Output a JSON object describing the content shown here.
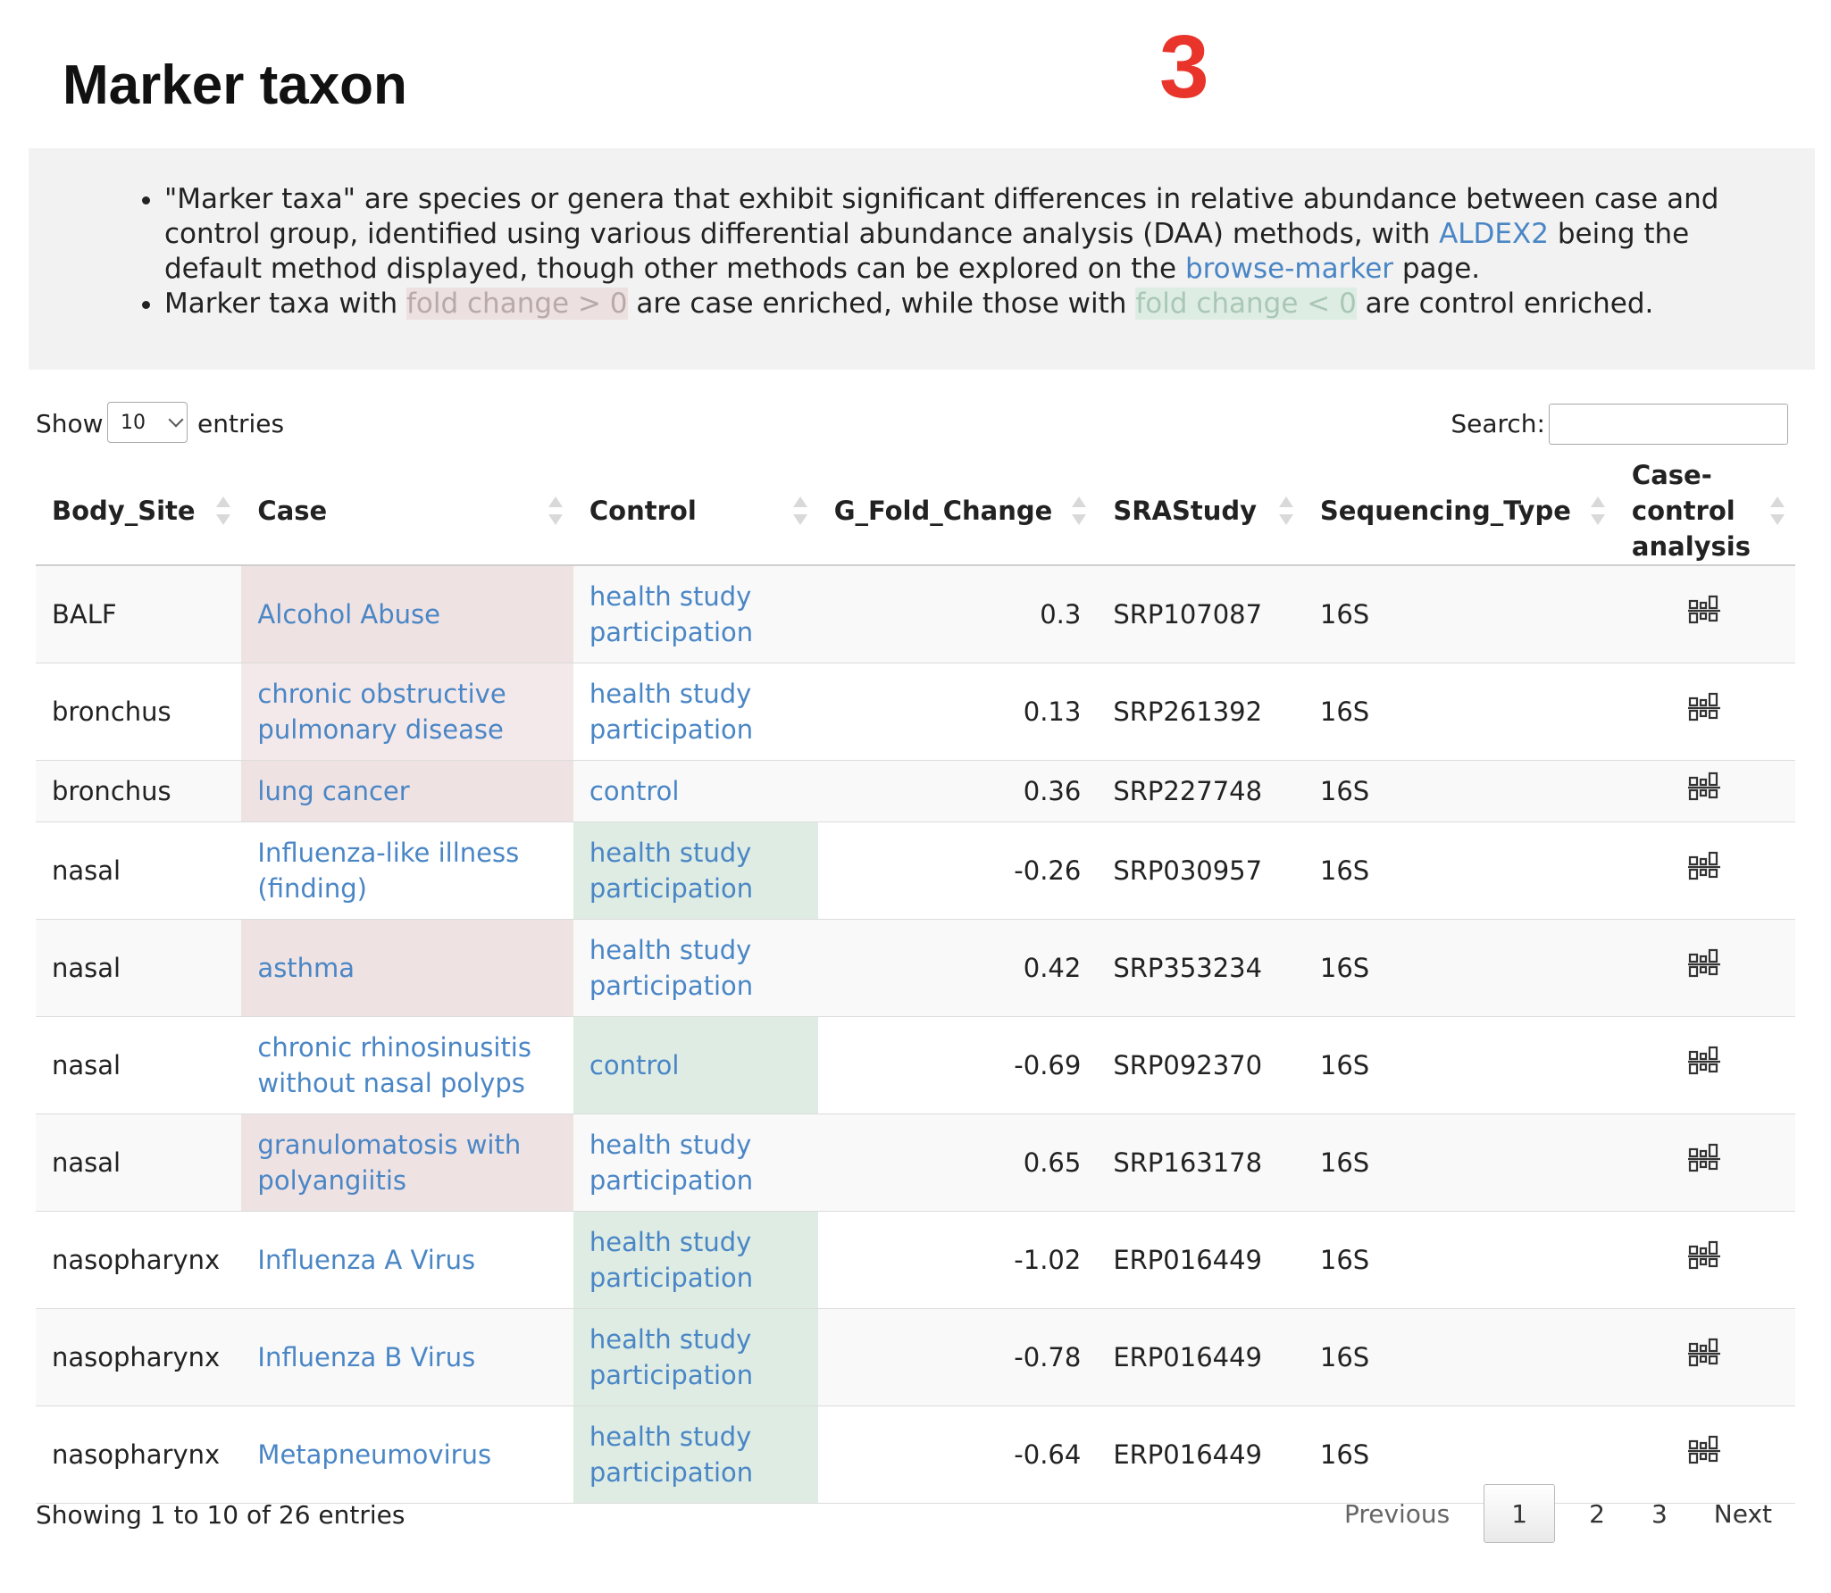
{
  "page": {
    "title": "Marker taxon",
    "badge": "3"
  },
  "info": {
    "b1_p1": "\"Marker taxa\" are species or genera that exhibit significant differences in relative abundance between case and control group, identified using various differential abundance analysis (DAA) methods, with ",
    "b1_link1": "ALDEX2",
    "b1_p2": " being the default method displayed, though other methods can be explored on the ",
    "b1_link2": "browse-marker",
    "b1_p3": " page.",
    "b2_p1": "Marker taxa with ",
    "b2_hl1": "fold change > 0",
    "b2_p2": " are case enriched, while those with ",
    "b2_hl2": "fold change < 0",
    "b2_p3": " are control enriched."
  },
  "controls": {
    "show_label": "Show",
    "page_length": "10",
    "entries_label": "entries",
    "search_label": "Search:",
    "search_value": ""
  },
  "table": {
    "headers": [
      "Body_Site",
      "Case",
      "Control",
      "G_Fold_Change",
      "SRAStudy",
      "Sequencing_Type",
      "Case-control analysis"
    ],
    "rows": [
      {
        "body_site": "BALF",
        "case": "Alcohol Abuse",
        "control": "health study participation",
        "fold": "0.3",
        "study": "SRP107087",
        "seq": "16S",
        "icon": "case-control-analysis-icon"
      },
      {
        "body_site": "bronchus",
        "case": "chronic obstructive pulmonary disease",
        "control": "health study participation",
        "fold": "0.13",
        "study": "SRP261392",
        "seq": "16S",
        "icon": "case-control-analysis-icon"
      },
      {
        "body_site": "bronchus",
        "case": "lung cancer",
        "control": "control",
        "fold": "0.36",
        "study": "SRP227748",
        "seq": "16S",
        "icon": "case-control-analysis-icon"
      },
      {
        "body_site": "nasal",
        "case": "Influenza-like illness (finding)",
        "control": "health study participation",
        "fold": "-0.26",
        "study": "SRP030957",
        "seq": "16S",
        "icon": "case-control-analysis-icon"
      },
      {
        "body_site": "nasal",
        "case": "asthma",
        "control": "health study participation",
        "fold": "0.42",
        "study": "SRP353234",
        "seq": "16S",
        "icon": "case-control-analysis-icon"
      },
      {
        "body_site": "nasal",
        "case": "chronic rhinosinusitis without nasal polyps",
        "control": "control",
        "fold": "-0.69",
        "study": "SRP092370",
        "seq": "16S",
        "icon": "case-control-analysis-icon"
      },
      {
        "body_site": "nasal",
        "case": "granulomatosis with polyangiitis",
        "control": "health study participation",
        "fold": "0.65",
        "study": "SRP163178",
        "seq": "16S",
        "icon": "case-control-analysis-icon"
      },
      {
        "body_site": "nasopharynx",
        "case": "Influenza A Virus",
        "control": "health study participation",
        "fold": "-1.02",
        "study": "ERP016449",
        "seq": "16S",
        "icon": "case-control-analysis-icon"
      },
      {
        "body_site": "nasopharynx",
        "case": "Influenza B Virus",
        "control": "health study participation",
        "fold": "-0.78",
        "study": "ERP016449",
        "seq": "16S",
        "icon": "case-control-analysis-icon"
      },
      {
        "body_site": "nasopharynx",
        "case": "Metapneumovirus",
        "control": "health study participation",
        "fold": "-0.64",
        "study": "ERP016449",
        "seq": "16S",
        "icon": "case-control-analysis-icon"
      }
    ]
  },
  "footer": {
    "info": "Showing 1 to 10 of 26 entries",
    "previous": "Previous",
    "pages": [
      "1",
      "2",
      "3"
    ],
    "next": "Next"
  },
  "colors": {
    "link": "#4a86c5",
    "case_enriched": "#eee2e3",
    "control_enriched": "#deece4",
    "badge": "#e8342a"
  }
}
